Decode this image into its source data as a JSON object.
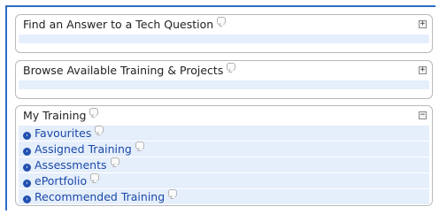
{
  "panels": [
    {
      "title": "Find an Answer to a Tech Question",
      "toggle": "+"
    },
    {
      "title": "Browse Available Training & Projects",
      "toggle": "+"
    },
    {
      "title": "My Training",
      "toggle": "−",
      "items": [
        {
          "label": "Favourites"
        },
        {
          "label": "Assigned Training"
        },
        {
          "label": "Assessments"
        },
        {
          "label": "ePortfolio"
        },
        {
          "label": "Recommended Training"
        }
      ]
    }
  ],
  "colors": {
    "accent": "#2b6cc4",
    "strip": "#e5eefb",
    "link": "#1a49a8",
    "bullet": "#1f4fb1"
  },
  "icons": {
    "help": "help-bubble-icon",
    "expand": "plus-box-icon",
    "collapse": "minus-box-icon",
    "bullet": "arrow-circle-icon"
  }
}
